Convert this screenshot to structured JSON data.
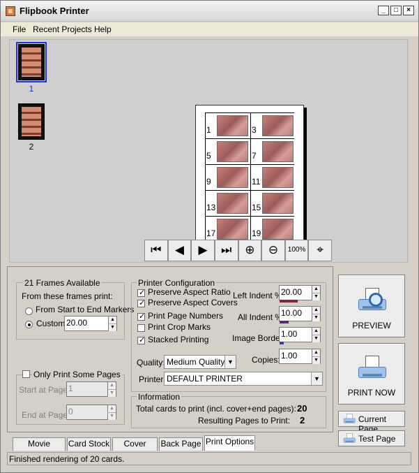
{
  "window": {
    "title": "Flipbook Printer",
    "controls": [
      "_",
      "□",
      "×"
    ]
  },
  "menu": [
    "File",
    "Recent Projects",
    "Help"
  ],
  "thumbnails": [
    {
      "label": "1",
      "selected": true
    },
    {
      "label": "2",
      "selected": false
    }
  ],
  "preview_page": {
    "frame_numbers": [
      "1",
      "3",
      "5",
      "7",
      "9",
      "11",
      "13",
      "15",
      "17",
      "19"
    ]
  },
  "navigation": [
    "⏮",
    "◀",
    "▶",
    "⏭",
    "⊕",
    "⊖",
    "100%",
    "⌖"
  ],
  "frames": {
    "title": "21 Frames Available",
    "subtitle": "From these frames print:",
    "option_start_end": "From Start to End Markers",
    "option_custom": "Custom:",
    "custom_value": "20.00"
  },
  "pages": {
    "title": "Only Print Some Pages",
    "start_label": "Start at Page:",
    "start_value": "1",
    "end_label": "End at Page:",
    "end_value": "0"
  },
  "printer_config": {
    "title": "Printer Configuration",
    "preserve_aspect_ratio": "Preserve Aspect Ratio",
    "preserve_aspect_covers": "Preserve Aspect Covers",
    "print_page_numbers": "Print Page Numbers",
    "print_crop_marks": "Print Crop Marks",
    "stacked_printing": "Stacked Printing",
    "left_indent_label": "Left Indent %:",
    "left_indent_value": "20.00",
    "all_indent_label": "All Indent %:",
    "all_indent_value": "10.00",
    "image_border_label": "Image Border:",
    "image_border_value": "1.00",
    "copies_label": "Copies:",
    "copies_value": "1.00",
    "quality_label": "Quality:",
    "quality_value": "Medium Quality",
    "printer_label": "Printer:",
    "printer_value": "DEFAULT PRINTER"
  },
  "information": {
    "title": "Information",
    "total_cards_label": "Total cards to print (incl. cover+end pages):",
    "total_cards_value": "20",
    "resulting_pages_label": "Resulting Pages to Print:",
    "resulting_pages_value": "2"
  },
  "buttons": {
    "preview": "PREVIEW",
    "print_now": "PRINT NOW",
    "current_page": "Current Page",
    "test_page": "Test Page"
  },
  "tabs": [
    "Movie Control",
    "Card Stock",
    "Cover Page",
    "Back Page",
    "Print Options"
  ],
  "status": "Finished rendering of 20 cards."
}
